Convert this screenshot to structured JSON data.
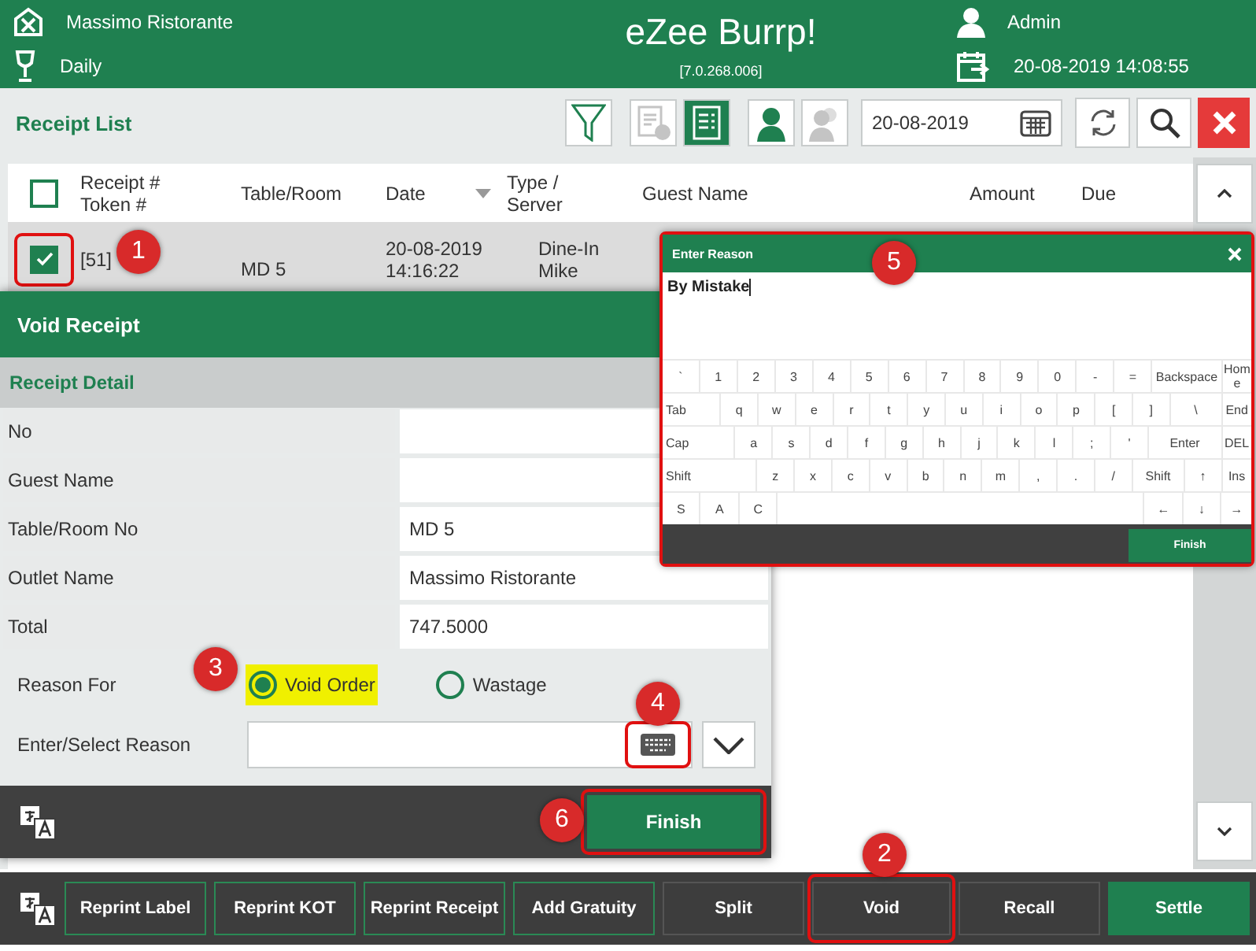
{
  "header": {
    "outlet": "Massimo Ristorante",
    "period": "Daily",
    "app_title": "eZee Burrp!",
    "version": "[7.0.268.006]",
    "user": "Admin",
    "datetime": "20-08-2019 14:08:55"
  },
  "toolbar": {
    "title": "Receipt List",
    "date": "20-08-2019",
    "view_toggles": [
      {
        "kind": "doc-star",
        "selected": false
      },
      {
        "kind": "doc-list",
        "selected": true
      }
    ],
    "guest_toggles": [
      {
        "kind": "single",
        "selected": true
      },
      {
        "kind": "group",
        "selected": false
      }
    ]
  },
  "list": {
    "select_all_checked": false,
    "columns": [
      {
        "label": "Receipt #\nToken #",
        "sorted": false
      },
      {
        "label": "Table/Room",
        "sorted": false
      },
      {
        "label": "Date",
        "sorted": true
      },
      {
        "label": "Type /\nServer",
        "sorted": false
      },
      {
        "label": "Guest Name",
        "sorted": false
      },
      {
        "label": "Amount",
        "sorted": false
      },
      {
        "label": "Due",
        "sorted": false
      }
    ],
    "rows": [
      {
        "checked": true,
        "marked": true,
        "receipt": "[51]",
        "table": "MD 5",
        "date": "20-08-2019\n14:16:22",
        "type": "Dine-In\nMike"
      }
    ]
  },
  "void_dialog": {
    "title": "Void Receipt",
    "section": "Receipt Detail",
    "fields": [
      {
        "label": "No"
      },
      {
        "label": "Guest Name"
      },
      {
        "label": "Table/Room No",
        "value": "MD 5"
      },
      {
        "label": "Outlet Name",
        "value": "Massimo Ristorante"
      },
      {
        "label": "Total",
        "value": "747.5000"
      }
    ],
    "reason_label": "Reason For",
    "reasons": [
      {
        "label": "Void Order",
        "selected": true,
        "highlighted": true
      },
      {
        "label": "Wastage",
        "selected": false,
        "highlighted": false
      }
    ],
    "reason_field_label": "Enter/Select Reason",
    "keyboard_marked": true,
    "finish": {
      "label": "Finish",
      "marked": true
    }
  },
  "keyboard_dialog": {
    "title": "Enter Reason",
    "text": "By Mistake",
    "marked": true,
    "key_rows": [
      {
        "keys": [
          "`",
          "1",
          "2",
          "3",
          "4",
          "5",
          "6",
          "7",
          "8",
          "9",
          "0",
          "-",
          "=",
          "Backspace",
          "Home"
        ]
      },
      {
        "keys": [
          "Tab",
          "q",
          "w",
          "e",
          "r",
          "t",
          "y",
          "u",
          "i",
          "o",
          "p",
          "[",
          "]",
          "\\",
          "End"
        ]
      },
      {
        "keys": [
          "Cap",
          "a",
          "s",
          "d",
          "f",
          "g",
          "h",
          "j",
          "k",
          "l",
          ";",
          "'",
          "Enter",
          "DEL"
        ]
      },
      {
        "keys": [
          "Shift",
          "z",
          "x",
          "c",
          "v",
          "b",
          "n",
          "m",
          ",",
          ".",
          "/",
          "Shift",
          "↑",
          "Ins"
        ]
      },
      {
        "keys": [
          "S",
          "A",
          "C"
        ],
        "space_bar": true,
        "keys_after": [
          "←",
          "↓",
          "→"
        ]
      }
    ],
    "finish": "Finish"
  },
  "bottom_bar": {
    "buttons": [
      {
        "label": "Reprint Label",
        "kind": "outlined",
        "marked": false
      },
      {
        "label": "Reprint KOT",
        "kind": "outlined",
        "marked": false
      },
      {
        "label": "Reprint Receipt",
        "kind": "outlined",
        "marked": false
      },
      {
        "label": "Add Gratuity",
        "kind": "outlined",
        "marked": false
      },
      {
        "label": "Split",
        "kind": "plain",
        "marked": false
      },
      {
        "label": "Void",
        "kind": "plain",
        "marked": true
      },
      {
        "label": "Recall",
        "kind": "plain",
        "marked": false
      },
      {
        "label": "Settle",
        "kind": "primary",
        "marked": false
      }
    ]
  },
  "annotations": [
    {
      "number": "1"
    },
    {
      "number": "2"
    },
    {
      "number": "3"
    },
    {
      "number": "4"
    },
    {
      "number": "5"
    },
    {
      "number": "6"
    }
  ]
}
